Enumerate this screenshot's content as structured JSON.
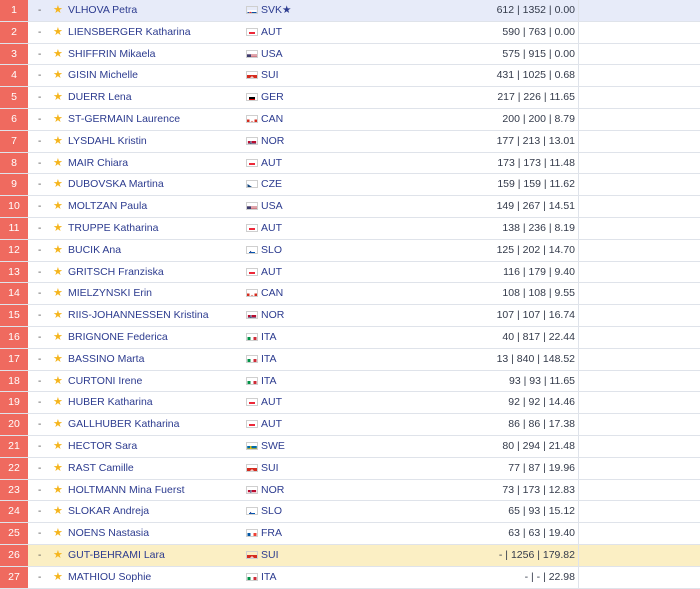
{
  "rows": [
    {
      "rank": "1",
      "dash": "-",
      "name": "VLHOVA Petra",
      "nation": "SVK★",
      "flag": "svk",
      "stats": "612 | 1352 | 0.00",
      "highlight": "blue"
    },
    {
      "rank": "2",
      "dash": "-",
      "name": "LIENSBERGER Katharina",
      "nation": "AUT",
      "flag": "aut",
      "stats": "590 | 763 | 0.00"
    },
    {
      "rank": "3",
      "dash": "-",
      "name": "SHIFFRIN Mikaela",
      "nation": "USA",
      "flag": "usa",
      "stats": "575 | 915 | 0.00"
    },
    {
      "rank": "4",
      "dash": "-",
      "name": "GISIN Michelle",
      "nation": "SUI",
      "flag": "sui",
      "stats": "431 | 1025 | 0.68"
    },
    {
      "rank": "5",
      "dash": "-",
      "name": "DUERR Lena",
      "nation": "GER",
      "flag": "ger",
      "stats": "217 | 226 | 11.65"
    },
    {
      "rank": "6",
      "dash": "-",
      "name": "ST-GERMAIN Laurence",
      "nation": "CAN",
      "flag": "can",
      "stats": "200 | 200 | 8.79"
    },
    {
      "rank": "7",
      "dash": "-",
      "name": "LYSDAHL Kristin",
      "nation": "NOR",
      "flag": "nor",
      "stats": "177 | 213 | 13.01"
    },
    {
      "rank": "8",
      "dash": "-",
      "name": "MAIR Chiara",
      "nation": "AUT",
      "flag": "aut",
      "stats": "173 | 173 | 11.48"
    },
    {
      "rank": "9",
      "dash": "-",
      "name": "DUBOVSKA Martina",
      "nation": "CZE",
      "flag": "cze",
      "stats": "159 | 159 | 11.62"
    },
    {
      "rank": "10",
      "dash": "-",
      "name": "MOLTZAN Paula",
      "nation": "USA",
      "flag": "usa",
      "stats": "149 | 267 | 14.51"
    },
    {
      "rank": "11",
      "dash": "-",
      "name": "TRUPPE Katharina",
      "nation": "AUT",
      "flag": "aut",
      "stats": "138 | 236 | 8.19"
    },
    {
      "rank": "12",
      "dash": "-",
      "name": "BUCIK Ana",
      "nation": "SLO",
      "flag": "slo",
      "stats": "125 | 202 | 14.70"
    },
    {
      "rank": "13",
      "dash": "-",
      "name": "GRITSCH Franziska",
      "nation": "AUT",
      "flag": "aut",
      "stats": "116 | 179 | 9.40"
    },
    {
      "rank": "14",
      "dash": "-",
      "name": "MIELZYNSKI Erin",
      "nation": "CAN",
      "flag": "can",
      "stats": "108 | 108 | 9.55"
    },
    {
      "rank": "15",
      "dash": "-",
      "name": "RIIS-JOHANNESSEN Kristina",
      "nation": "NOR",
      "flag": "nor",
      "stats": "107 | 107 | 16.74"
    },
    {
      "rank": "16",
      "dash": "-",
      "name": "BRIGNONE Federica",
      "nation": "ITA",
      "flag": "ita",
      "stats": "40 | 817 | 22.44"
    },
    {
      "rank": "17",
      "dash": "-",
      "name": "BASSINO Marta",
      "nation": "ITA",
      "flag": "ita",
      "stats": "13 | 840 | 148.52"
    },
    {
      "rank": "18",
      "dash": "-",
      "name": "CURTONI Irene",
      "nation": "ITA",
      "flag": "ita",
      "stats": "93 | 93 | 11.65"
    },
    {
      "rank": "19",
      "dash": "-",
      "name": "HUBER Katharina",
      "nation": "AUT",
      "flag": "aut",
      "stats": "92 | 92 | 14.46"
    },
    {
      "rank": "20",
      "dash": "-",
      "name": "GALLHUBER Katharina",
      "nation": "AUT",
      "flag": "aut",
      "stats": "86 | 86 | 17.38"
    },
    {
      "rank": "21",
      "dash": "-",
      "name": "HECTOR Sara",
      "nation": "SWE",
      "flag": "swe",
      "stats": "80 | 294 | 21.48"
    },
    {
      "rank": "22",
      "dash": "-",
      "name": "RAST Camille",
      "nation": "SUI",
      "flag": "sui",
      "stats": "77 | 87 | 19.96"
    },
    {
      "rank": "23",
      "dash": "-",
      "name": "HOLTMANN Mina Fuerst",
      "nation": "NOR",
      "flag": "nor",
      "stats": "73 | 173 | 12.83"
    },
    {
      "rank": "24",
      "dash": "-",
      "name": "SLOKAR Andreja",
      "nation": "SLO",
      "flag": "slo",
      "stats": "65 | 93 | 15.12"
    },
    {
      "rank": "25",
      "dash": "-",
      "name": "NOENS Nastasia",
      "nation": "FRA",
      "flag": "fra",
      "stats": "63 | 63 | 19.40"
    },
    {
      "rank": "26",
      "dash": "-",
      "name": "GUT-BEHRAMI Lara",
      "nation": "SUI",
      "flag": "sui",
      "stats": "- | 1256 | 179.82",
      "highlight": "yellow"
    },
    {
      "rank": "27",
      "dash": "-",
      "name": "MATHIOU Sophie",
      "nation": "ITA",
      "flag": "ita",
      "stats": "- | - | 22.98"
    }
  ],
  "colors": {
    "rank_bg": "#ef6a5f",
    "star": "#f5b51d",
    "name_text": "#2c3b8f",
    "highlight_blue": "#e7ebf9",
    "highlight_yellow": "#fbefc4"
  },
  "icons": {
    "favorite": "star-icon",
    "flag": "flag-icon"
  }
}
